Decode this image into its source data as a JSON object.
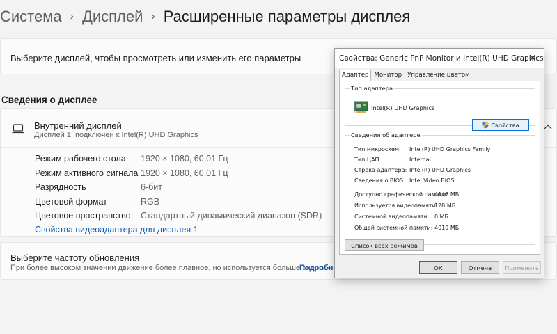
{
  "breadcrumb": {
    "items": [
      "Система",
      "Дисплей"
    ],
    "current": "Расширенные параметры дисплея"
  },
  "select_display": {
    "text": "Выберите дисплей, чтобы просмотреть или изменить его параметры"
  },
  "display_info": {
    "section_title": "Сведения о дисплее",
    "name": "Внутренний дисплей",
    "subtitle": "Дисплей 1: подключен к Intel(R) UHD Graphics",
    "rows": [
      {
        "key": "Режим рабочего стола",
        "value": "1920 × 1080, 60,01 Гц"
      },
      {
        "key": "Режим активного сигнала",
        "value": "1920 × 1080, 60,01 Гц"
      },
      {
        "key": "Разрядность",
        "value": "6-бит"
      },
      {
        "key": "Цветовой формат",
        "value": "RGB"
      },
      {
        "key": "Цветовое пространство",
        "value": "Стандартный динамический диапазон (SDR)"
      }
    ],
    "adapter_link": "Свойства видеоадаптера для дисплея 1"
  },
  "refresh": {
    "title": "Выберите частоту обновления",
    "subtitle": "При более высоком значении движение более плавное, но используется больше энергии",
    "link": "Подробнее"
  },
  "dialog": {
    "title": "Свойства: Generic PnP Monitor и Intel(R) UHD Graphics",
    "tabs": [
      "Адаптер",
      "Монитор",
      "Управление цветом"
    ],
    "adapter_type_legend": "Тип адаптера",
    "adapter_name": "Intel(R) UHD Graphics",
    "properties_button": "Свойства",
    "adapter_info_legend": "Сведения об адаптере",
    "info": [
      {
        "key": "Тип микросхем:",
        "value": "Intel(R) UHD Graphics Family"
      },
      {
        "key": "Тип ЦАП:",
        "value": "Internal"
      },
      {
        "key": "Строка адаптера:",
        "value": "Intel(R) UHD Graphics"
      },
      {
        "key": "Сведения о BIOS:",
        "value": "Intel Video BIOS"
      }
    ],
    "memory": [
      {
        "key": "Доступно графической памяти:",
        "value": "4147 МБ"
      },
      {
        "key": "Используется видеопамяти:",
        "value": "128 МБ"
      },
      {
        "key": "Системной видеопамяти:",
        "value": "0 МБ"
      },
      {
        "key": "Общей системной памяти:",
        "value": "4019 МБ"
      }
    ],
    "list_modes_button": "Список всех режимов",
    "ok": "ОК",
    "cancel": "Отмена",
    "apply": "Применить"
  }
}
